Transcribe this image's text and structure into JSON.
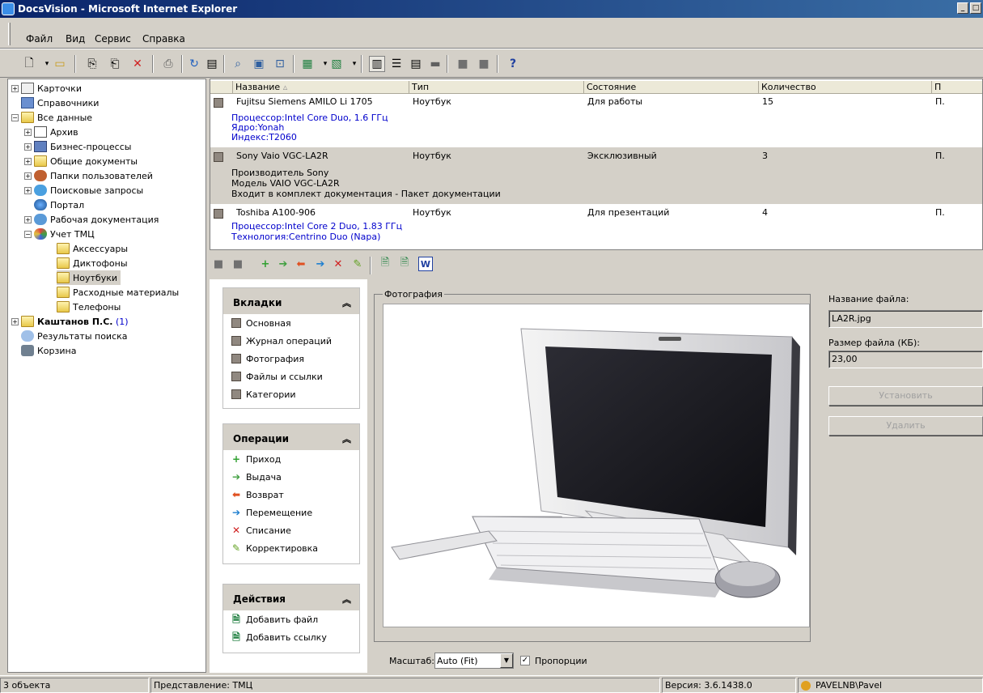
{
  "window": {
    "title": "DocsVision - Microsoft Internet Explorer"
  },
  "menu": {
    "items": [
      "Файл",
      "Вид",
      "Сервис",
      "Справка"
    ]
  },
  "tree": {
    "items": [
      {
        "label": "Карточки"
      },
      {
        "label": "Справочники"
      },
      {
        "label": "Все данные"
      },
      {
        "label": "Архив"
      },
      {
        "label": "Бизнес-процессы"
      },
      {
        "label": "Общие документы"
      },
      {
        "label": "Папки пользователей"
      },
      {
        "label": "Поисковые запросы"
      },
      {
        "label": "Портал"
      },
      {
        "label": "Рабочая документация"
      },
      {
        "label": "Учет ТМЦ"
      },
      {
        "label": "Аксессуары"
      },
      {
        "label": "Диктофоны"
      },
      {
        "label": "Ноутбуки"
      },
      {
        "label": "Расходные материалы"
      },
      {
        "label": "Телефоны"
      },
      {
        "label": "Каштанов П.С.",
        "count": "(1)"
      },
      {
        "label": "Результаты поиска"
      },
      {
        "label": "Корзина"
      }
    ]
  },
  "grid": {
    "columns": [
      "Название",
      "Тип",
      "Состояние",
      "Количество",
      "П"
    ],
    "rows": [
      {
        "name": "Fujitsu Siemens AMILO Li 1705",
        "type": "Ноутбук",
        "state": "Для работы",
        "qty": "15",
        "p": "П.",
        "details": [
          "Процессор:Intel Core Duo, 1.6 ГГц",
          "Ядро:Yonah",
          "Индекс:T2060"
        ]
      },
      {
        "name": "Sony Vaio VGC-LA2R",
        "type": "Ноутбук",
        "state": "Эксклюзивный",
        "qty": "3",
        "p": "П.",
        "details": [
          "Производитель Sony",
          "Модель VAIO VGC-LA2R",
          "Входит в комплект документация - Пакет документации"
        ]
      },
      {
        "name": "Toshiba A100-906",
        "type": "Ноутбук",
        "state": "Для презентаций",
        "qty": "4",
        "p": "П.",
        "details": [
          "Процессор:Intel Core 2 Duo, 1.83 ГГц",
          "Технология:Centrino Duo (Napa)"
        ]
      }
    ]
  },
  "panel": {
    "tabs_title": "Вкладки",
    "tabs": [
      "Основная",
      "Журнал операций",
      "Фотография",
      "Файлы и ссылки",
      "Категории"
    ],
    "ops_title": "Операции",
    "ops": [
      "Приход",
      "Выдача",
      "Возврат",
      "Перемещение",
      "Списание",
      "Корректировка"
    ],
    "actions_title": "Действия",
    "actions": [
      "Добавить файл",
      "Добавить ссылку"
    ]
  },
  "photo": {
    "legend": "Фотография",
    "file_name_label": "Название файла:",
    "file_name": "LA2R.jpg",
    "file_size_label": "Размер файла (КБ):",
    "file_size": "23,00",
    "set_button": "Установить",
    "delete_button": "Удалить",
    "scale_label": "Масштаб:",
    "scale_value": "Auto (Fit)",
    "proportions_label": "Пропорции"
  },
  "status": {
    "objects": "3 объекта",
    "view": "Представление: ТМЦ",
    "version": "Версия: 3.6.1438.0",
    "user": "PAVELNB\\Pavel"
  }
}
